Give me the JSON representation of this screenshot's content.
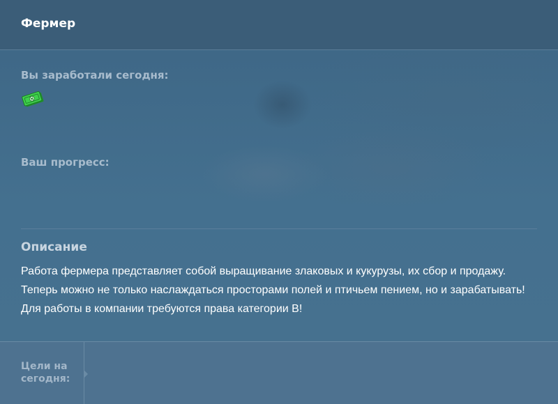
{
  "header": {
    "title": "Фермер"
  },
  "earnings": {
    "label": "Вы заработали сегодня:",
    "icon": "money-bill-icon"
  },
  "progress": {
    "label": "Ваш прогресс:"
  },
  "description": {
    "title": "Описание",
    "lines": [
      "Работа фермера представляет собой выращивание злаковых и кукурузы, их сбор и продажу.",
      "Теперь можно не только наслаждаться просторами полей и птичьем пением, но и зарабатывать!",
      "Для работы в компании требуются права категории B!"
    ]
  },
  "footer": {
    "goals_label": "Цели на сегодня:"
  },
  "colors": {
    "background": "#3f6887",
    "header": "#3b5d78",
    "footer": "#4e7290",
    "money_green": "#2fbf3a"
  }
}
